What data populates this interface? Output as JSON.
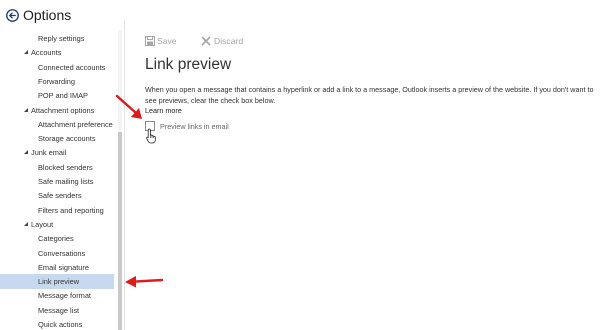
{
  "window": {
    "title": "Options"
  },
  "sidebar": {
    "items": [
      {
        "type": "item",
        "label": "Reply settings"
      },
      {
        "type": "group",
        "label": "Accounts"
      },
      {
        "type": "item",
        "label": "Connected accounts"
      },
      {
        "type": "item",
        "label": "Forwarding"
      },
      {
        "type": "item",
        "label": "POP and IMAP"
      },
      {
        "type": "group",
        "label": "Attachment options"
      },
      {
        "type": "item",
        "label": "Attachment preference"
      },
      {
        "type": "item",
        "label": "Storage accounts"
      },
      {
        "type": "group",
        "label": "Junk email"
      },
      {
        "type": "item",
        "label": "Blocked senders"
      },
      {
        "type": "item",
        "label": "Safe mailing lists"
      },
      {
        "type": "item",
        "label": "Safe senders"
      },
      {
        "type": "item",
        "label": "Filters and reporting"
      },
      {
        "type": "group",
        "label": "Layout"
      },
      {
        "type": "item",
        "label": "Categories"
      },
      {
        "type": "item",
        "label": "Conversations"
      },
      {
        "type": "item",
        "label": "Email signature"
      },
      {
        "type": "item",
        "label": "Link preview",
        "selected": true
      },
      {
        "type": "item",
        "label": "Message format"
      },
      {
        "type": "item",
        "label": "Message list"
      },
      {
        "type": "item",
        "label": "Quick actions"
      }
    ]
  },
  "toolbar": {
    "save_label": "Save",
    "discard_label": "Discard"
  },
  "main": {
    "title": "Link preview",
    "description": "When you open a message that contains a hyperlink or add a link to a message, Outlook inserts a preview of the website. If you don't want to see previews, clear the check box below.",
    "learn_more": "Learn more",
    "checkbox_label": "Preview links in email",
    "checkbox_checked": false
  },
  "colors": {
    "selected_bg": "#c7d9ee",
    "annotation_arrow": "#e0191b",
    "toolbar_disabled": "#a6a6a6"
  }
}
